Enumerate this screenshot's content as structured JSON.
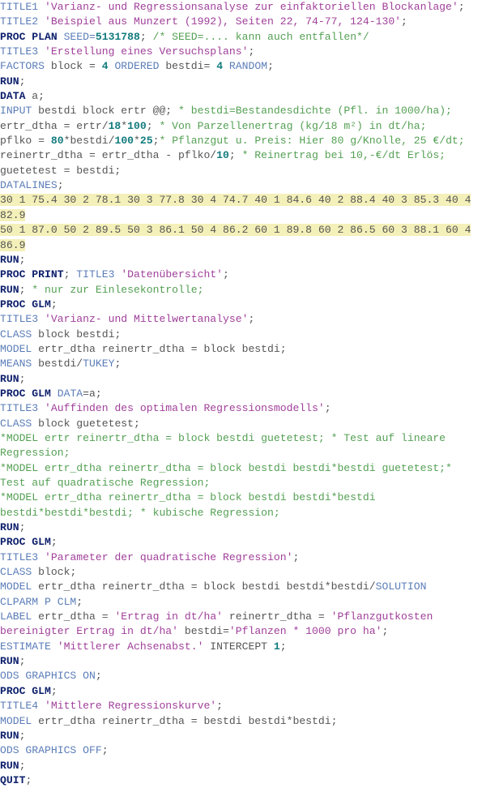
{
  "document": {
    "language": "SAS",
    "lines": [
      {
        "tokens": [
          [
            "kw",
            "TITLE1 "
          ],
          [
            "str",
            "'Varianz- und Regressionsanalyse zur einfaktoriellen Blockanlage'"
          ],
          [
            "txt",
            ";"
          ]
        ]
      },
      {
        "tokens": [
          [
            "kw",
            "TITLE2 "
          ],
          [
            "str",
            "'Beispiel aus Munzert (1992), Seiten 22, 74-77, 124-130'"
          ],
          [
            "txt",
            ";"
          ]
        ]
      },
      {
        "tokens": [
          [
            "proc",
            "PROC PLAN"
          ],
          [
            "txt",
            " "
          ],
          [
            "kw",
            "SEED="
          ],
          [
            "num",
            "5131788"
          ],
          [
            "txt",
            "; "
          ],
          [
            "cmt",
            "/* SEED=.... kann auch entfallen*/"
          ]
        ]
      },
      {
        "tokens": [
          [
            "kw",
            "TITLE3 "
          ],
          [
            "str",
            "'Erstellung eines Versuchsplans'"
          ],
          [
            "txt",
            ";"
          ]
        ]
      },
      {
        "tokens": [
          [
            "kw",
            "FACTORS"
          ],
          [
            "txt",
            " block = "
          ],
          [
            "num",
            "4"
          ],
          [
            "txt",
            " "
          ],
          [
            "kw",
            "ORDERED"
          ],
          [
            "txt",
            " bestdi= "
          ],
          [
            "num",
            "4"
          ],
          [
            "txt",
            " "
          ],
          [
            "kw",
            "RANDOM"
          ],
          [
            "txt",
            ";"
          ]
        ]
      },
      {
        "tokens": [
          [
            "proc",
            "RUN"
          ],
          [
            "txt",
            ";"
          ]
        ]
      },
      {
        "tokens": [
          [
            "proc",
            "DATA"
          ],
          [
            "txt",
            " a;"
          ]
        ]
      },
      {
        "tokens": [
          [
            "kw",
            "INPUT"
          ],
          [
            "txt",
            " bestdi block ertr @@; "
          ],
          [
            "cmt",
            "* bestdi=Bestandesdichte (Pfl. in 1000/ha);"
          ]
        ]
      },
      {
        "tokens": [
          [
            "txt",
            "ertr_dtha = ertr/"
          ],
          [
            "num",
            "18"
          ],
          [
            "txt",
            "*"
          ],
          [
            "num",
            "100"
          ],
          [
            "txt",
            "; "
          ],
          [
            "cmt",
            "* Von Parzellenertrag (kg/18 m²) in dt/ha;"
          ]
        ]
      },
      {
        "tokens": [
          [
            "txt",
            "pflko = "
          ],
          [
            "num",
            "80"
          ],
          [
            "txt",
            "*bestdi/"
          ],
          [
            "num",
            "100"
          ],
          [
            "txt",
            "*"
          ],
          [
            "num",
            "25"
          ],
          [
            "txt",
            ";"
          ],
          [
            "cmt",
            "* Pflanzgut u. Preis: Hier 80 g/Knolle, 25 €/dt;"
          ]
        ]
      },
      {
        "tokens": [
          [
            "txt",
            "reinertr_dtha = ertr_dtha - pflko/"
          ],
          [
            "num",
            "10"
          ],
          [
            "txt",
            "; "
          ],
          [
            "cmt",
            "* Reinertrag bei 10,-€/dt Erlös;"
          ]
        ]
      },
      {
        "tokens": [
          [
            "txt",
            "guetetest = bestdi;"
          ]
        ]
      },
      {
        "tokens": [
          [
            "kw",
            "DATALINES"
          ],
          [
            "txt",
            ";"
          ]
        ]
      },
      {
        "hl": true,
        "tokens": [
          [
            "data",
            "30 1 75.4 30 2 78.1 30 3 77.8 30 4 74.7 40 1 84.6 40 2 88.4 40 3 85.3 40 4"
          ]
        ]
      },
      {
        "hl": true,
        "tokens": [
          [
            "data",
            "82.9"
          ]
        ]
      },
      {
        "hl": true,
        "tokens": [
          [
            "data",
            "50 1 87.0 50 2 89.5 50 3 86.1 50 4 86.2 60 1 89.8 60 2 86.5 60 3 88.1 60 4"
          ]
        ]
      },
      {
        "hl": true,
        "tokens": [
          [
            "data",
            "86.9"
          ]
        ]
      },
      {
        "tokens": [
          [
            "proc",
            "RUN"
          ],
          [
            "txt",
            ";"
          ]
        ]
      },
      {
        "tokens": [
          [
            "proc",
            "PROC PRINT"
          ],
          [
            "txt",
            "; "
          ],
          [
            "kw",
            "TITLE3 "
          ],
          [
            "str",
            "'Datenübersicht'"
          ],
          [
            "txt",
            ";"
          ]
        ]
      },
      {
        "tokens": [
          [
            "proc",
            "RUN"
          ],
          [
            "txt",
            "; "
          ],
          [
            "cmt",
            "* nur zur Einlesekontrolle;"
          ]
        ]
      },
      {
        "tokens": [
          [
            "proc",
            "PROC GLM"
          ],
          [
            "txt",
            ";"
          ]
        ]
      },
      {
        "tokens": [
          [
            "kw",
            "TITLE3 "
          ],
          [
            "str",
            "'Varianz- und Mittelwertanalyse'"
          ],
          [
            "txt",
            ";"
          ]
        ]
      },
      {
        "tokens": [
          [
            "kw",
            "CLASS"
          ],
          [
            "txt",
            " block bestdi;"
          ]
        ]
      },
      {
        "tokens": [
          [
            "kw",
            "MODEL"
          ],
          [
            "txt",
            " ertr_dtha reinertr_dtha = block bestdi;"
          ]
        ]
      },
      {
        "tokens": [
          [
            "kw",
            "MEANS"
          ],
          [
            "txt",
            " bestdi/"
          ],
          [
            "kw",
            "TUKEY"
          ],
          [
            "txt",
            ";"
          ]
        ]
      },
      {
        "tokens": [
          [
            "proc",
            "RUN"
          ],
          [
            "txt",
            ";"
          ]
        ]
      },
      {
        "tokens": [
          [
            "proc",
            "PROC GLM"
          ],
          [
            "txt",
            " "
          ],
          [
            "kw",
            "DATA"
          ],
          [
            "txt",
            "=a;"
          ]
        ]
      },
      {
        "tokens": [
          [
            "kw",
            "TITLE3 "
          ],
          [
            "str",
            "'Auffinden des optimalen Regressionsmodells'"
          ],
          [
            "txt",
            ";"
          ]
        ]
      },
      {
        "tokens": [
          [
            "kw",
            "CLASS"
          ],
          [
            "txt",
            " block guetetest;"
          ]
        ]
      },
      {
        "tokens": [
          [
            "cmt",
            "*MODEL ertr reinertr_dtha = block bestdi guetetest; * Test auf lineare"
          ]
        ]
      },
      {
        "tokens": [
          [
            "cmt",
            "Regression;"
          ]
        ]
      },
      {
        "tokens": [
          [
            "cmt",
            "*MODEL ertr_dtha reinertr_dtha = block bestdi bestdi*bestdi guetetest;*"
          ]
        ]
      },
      {
        "tokens": [
          [
            "cmt",
            "Test auf quadratische Regression;"
          ]
        ]
      },
      {
        "tokens": [
          [
            "cmt",
            "*MODEL ertr_dtha reinertr_dtha = block bestdi bestdi*bestdi"
          ]
        ]
      },
      {
        "tokens": [
          [
            "cmt",
            "bestdi*bestdi*bestdi; * kubische Regression;"
          ]
        ]
      },
      {
        "tokens": [
          [
            "proc",
            "RUN"
          ],
          [
            "txt",
            ";"
          ]
        ]
      },
      {
        "tokens": [
          [
            "proc",
            "PROC GLM"
          ],
          [
            "txt",
            ";"
          ]
        ]
      },
      {
        "tokens": [
          [
            "kw",
            "TITLE3 "
          ],
          [
            "str",
            "'Parameter der quadratische Regression'"
          ],
          [
            "txt",
            ";"
          ]
        ]
      },
      {
        "tokens": [
          [
            "kw",
            "CLASS"
          ],
          [
            "txt",
            " block;"
          ]
        ]
      },
      {
        "tokens": [
          [
            "kw",
            "MODEL"
          ],
          [
            "txt",
            " ertr_dtha reinertr_dtha = block bestdi bestdi*bestdi/"
          ],
          [
            "kw",
            "SOLUTION"
          ]
        ]
      },
      {
        "tokens": [
          [
            "kw",
            "CLPARM P CLM"
          ],
          [
            "txt",
            ";"
          ]
        ]
      },
      {
        "tokens": [
          [
            "kw",
            "LABEL"
          ],
          [
            "txt",
            " ertr_dtha = "
          ],
          [
            "str",
            "'Ertrag in dt/ha'"
          ],
          [
            "txt",
            " reinertr_dtha = "
          ],
          [
            "str",
            "'Pflanzgutkosten"
          ]
        ]
      },
      {
        "tokens": [
          [
            "str",
            "bereinigter Ertrag in dt/ha'"
          ],
          [
            "txt",
            " bestdi="
          ],
          [
            "str",
            "'Pflanzen * 1000 pro ha'"
          ],
          [
            "txt",
            ";"
          ]
        ]
      },
      {
        "tokens": [
          [
            "kw",
            "ESTIMATE "
          ],
          [
            "str",
            "'Mittlerer Achsenabst.'"
          ],
          [
            "txt",
            " INTERCEPT "
          ],
          [
            "num",
            "1"
          ],
          [
            "txt",
            ";"
          ]
        ]
      },
      {
        "tokens": [
          [
            "proc",
            "RUN"
          ],
          [
            "txt",
            ";"
          ]
        ]
      },
      {
        "tokens": [
          [
            "kw",
            "ODS GRAPHICS ON"
          ],
          [
            "txt",
            ";"
          ]
        ]
      },
      {
        "tokens": [
          [
            "proc",
            "PROC GLM"
          ],
          [
            "txt",
            ";"
          ]
        ]
      },
      {
        "tokens": [
          [
            "kw",
            "TITLE4 "
          ],
          [
            "str",
            "'Mittlere Regressionskurve'"
          ],
          [
            "txt",
            ";"
          ]
        ]
      },
      {
        "tokens": [
          [
            "kw",
            "MODEL"
          ],
          [
            "txt",
            " ertr_dtha reinertr_dtha = bestdi bestdi*bestdi;"
          ]
        ]
      },
      {
        "tokens": [
          [
            "proc",
            "RUN"
          ],
          [
            "txt",
            ";"
          ]
        ]
      },
      {
        "tokens": [
          [
            "kw",
            "ODS GRAPHICS OFF"
          ],
          [
            "txt",
            ";"
          ]
        ]
      },
      {
        "tokens": [
          [
            "proc",
            "RUN"
          ],
          [
            "txt",
            ";"
          ]
        ]
      },
      {
        "tokens": [
          [
            "proc",
            "QUIT"
          ],
          [
            "txt",
            ";"
          ]
        ]
      }
    ]
  }
}
